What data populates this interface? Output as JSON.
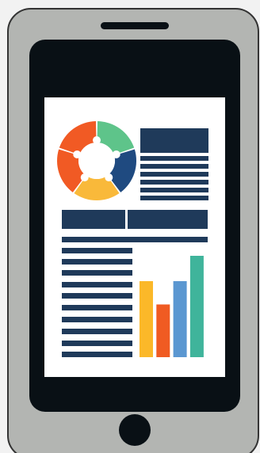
{
  "colors": {
    "phone_outline": "#333333",
    "phone_body": "#b3b5b2",
    "screen_frame": "#091015",
    "paper": "#ffffff",
    "text_block": "#1f3a5a"
  },
  "donut_segments": [
    {
      "color": "#5ec48a"
    },
    {
      "color": "#1f4a80"
    },
    {
      "color": "#f9b93a"
    },
    {
      "color": "#f15a24"
    },
    {
      "color": "#f15a24"
    }
  ],
  "chart_data": {
    "type": "bar",
    "categories": [
      "",
      "",
      "",
      ""
    ],
    "values": [
      0.75,
      0.52,
      0.75,
      1.0
    ],
    "ylim": [
      0,
      1
    ],
    "bar_colors": [
      "#fbb829",
      "#f05b22",
      "#5b97d1",
      "#3fb49b"
    ],
    "title": "",
    "xlabel": "",
    "ylabel": ""
  }
}
